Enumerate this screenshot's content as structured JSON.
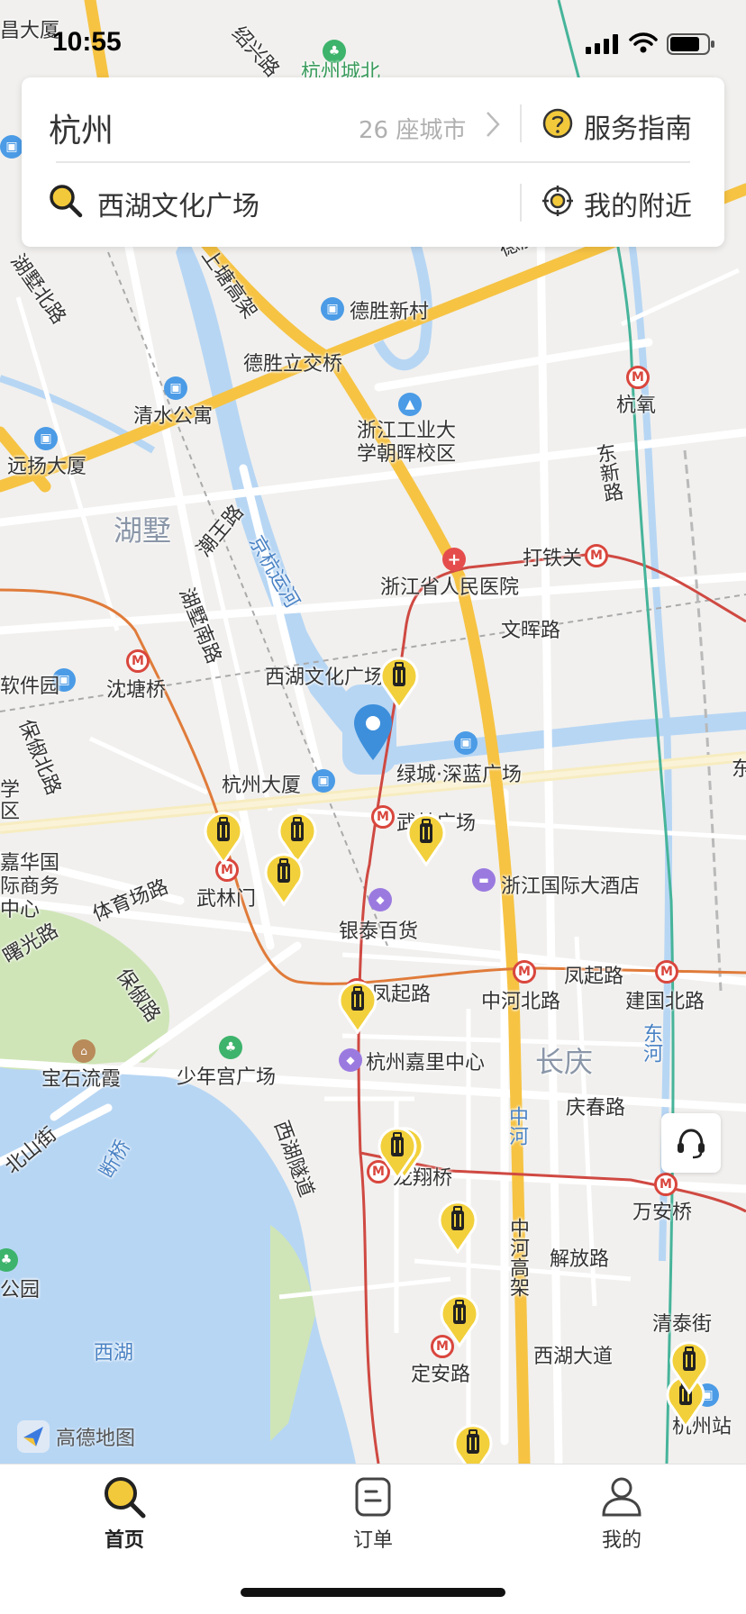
{
  "status_bar": {
    "time": "10:55"
  },
  "header": {
    "city": "杭州",
    "city_count": "26 座城市",
    "guide_label": "服务指南",
    "search_value": "西湖文化广场",
    "nearby_label": "我的附近"
  },
  "map": {
    "brand": "高德地图",
    "labels": {
      "changchang": "昌大厦",
      "shaoxing_rd": "绍兴路",
      "hangzhou_city_north": "杭州城北",
      "deshengxin": "德胜新村",
      "shangtang_elevated": "上塘高架",
      "desheng_flyover": "德胜立交桥",
      "desheng_rd": "德胜快",
      "hushu_north": "湖墅北路",
      "qingshui": "清水公寓",
      "zjut": "浙江工业大学朝晖校区",
      "hangyang": "杭氧",
      "dongxin_rd": "东新路",
      "yuanyang": "远扬大厦",
      "hushu": "湖墅",
      "chaowang_rd": "潮王路",
      "jinghang_canal": "京杭运河",
      "datieguan": "打铁关",
      "zj_hospital": "浙江省人民医院",
      "wenhui_rd": "文晖路",
      "hushu_south": "湖墅南路",
      "software_park": "软件园",
      "shentangqiao": "沈塘桥",
      "xihu_culture": "西湖文化广场",
      "baoshu_north": "保俶北路",
      "xueqiu": "学区",
      "hz_mansion": "杭州大厦",
      "lvcheng": "绿城·深蓝广场",
      "east_edge": "东",
      "wulin_square": "武林广场",
      "jiahua": "嘉华国际商务中心",
      "tiyuchang_rd": "体育场路",
      "wulinmen": "武林门",
      "zj_grand_hotel": "浙江国际大酒店",
      "guangming": "曙光路",
      "yintai": "银泰百货",
      "baoshu_rd": "保俶路",
      "fengqi_rd": "凤起路",
      "zhonghe_north": "中河北路",
      "fengqi_rd2": "凤起路",
      "jianguo_north": "建国北路",
      "east_river": "东河",
      "baoshi": "宝石流霞",
      "shaonian": "少年宫广场",
      "hz_kerry": "杭州嘉里中心",
      "changqing": "长庆",
      "qingchun_rd": "庆春路",
      "beishan_st": "北山街",
      "duanqiao": "断桥",
      "xihu_tunnel": "西湖隧道",
      "zhonghe": "中河",
      "longxiangqiao": "龙翔桥",
      "wananqiao": "万安桥",
      "park": "公园",
      "jiefang_rd": "解放路",
      "zhonghe_elevated": "中河高架",
      "xihu": "西湖",
      "xihu_avenue": "西湖大道",
      "qingtai_st": "清泰街",
      "dingan_rd": "定安路",
      "hz_station": "杭州站"
    }
  },
  "tabs": [
    {
      "label": "首页",
      "active": true
    },
    {
      "label": "订单",
      "active": false
    },
    {
      "label": "我的",
      "active": false
    }
  ]
}
